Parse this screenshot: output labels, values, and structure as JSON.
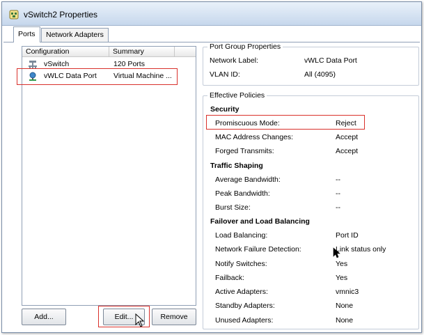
{
  "window": {
    "title": "vSwitch2 Properties",
    "icon": "vswitch-properties-icon"
  },
  "tabs": [
    {
      "label": "Ports",
      "active": true
    },
    {
      "label": "Network Adapters",
      "active": false
    }
  ],
  "port_list": {
    "columns": [
      "Configuration",
      "Summary"
    ],
    "rows": [
      {
        "icon": "vswitch-icon",
        "configuration": "vSwitch",
        "summary": "120 Ports"
      },
      {
        "icon": "port-group-icon",
        "configuration": "vWLC Data Port",
        "summary": "Virtual Machine ...",
        "highlighted": true
      }
    ]
  },
  "buttons": {
    "add": "Add...",
    "edit": "Edit...",
    "remove": "Remove"
  },
  "port_group_properties": {
    "title": "Port Group Properties",
    "network_label": {
      "label": "Network Label:",
      "value": "vWLC Data Port"
    },
    "vlan_id": {
      "label": "VLAN ID:",
      "value": "All (4095)"
    }
  },
  "effective_policies": {
    "title": "Effective Policies",
    "security": {
      "heading": "Security",
      "items": [
        {
          "label": "Promiscuous Mode:",
          "value": "Reject",
          "highlighted": true
        },
        {
          "label": "MAC Address Changes:",
          "value": "Accept"
        },
        {
          "label": "Forged Transmits:",
          "value": "Accept"
        }
      ]
    },
    "traffic_shaping": {
      "heading": "Traffic Shaping",
      "items": [
        {
          "label": "Average Bandwidth:",
          "value": "--"
        },
        {
          "label": "Peak Bandwidth:",
          "value": "--"
        },
        {
          "label": "Burst Size:",
          "value": "--"
        }
      ]
    },
    "failover": {
      "heading": "Failover and Load Balancing",
      "items": [
        {
          "label": "Load Balancing:",
          "value": "Port ID"
        },
        {
          "label": "Network Failure Detection:",
          "value": "Link status only"
        },
        {
          "label": "Notify Switches:",
          "value": "Yes"
        },
        {
          "label": "Failback:",
          "value": "Yes"
        },
        {
          "label": "Active Adapters:",
          "value": "vmnic3"
        },
        {
          "label": "Standby Adapters:",
          "value": "None"
        },
        {
          "label": "Unused Adapters:",
          "value": "None"
        }
      ]
    }
  },
  "colors": {
    "highlight": "#d9302b",
    "titlebar": "#c6d7ec",
    "border": "#8f9fb5"
  }
}
